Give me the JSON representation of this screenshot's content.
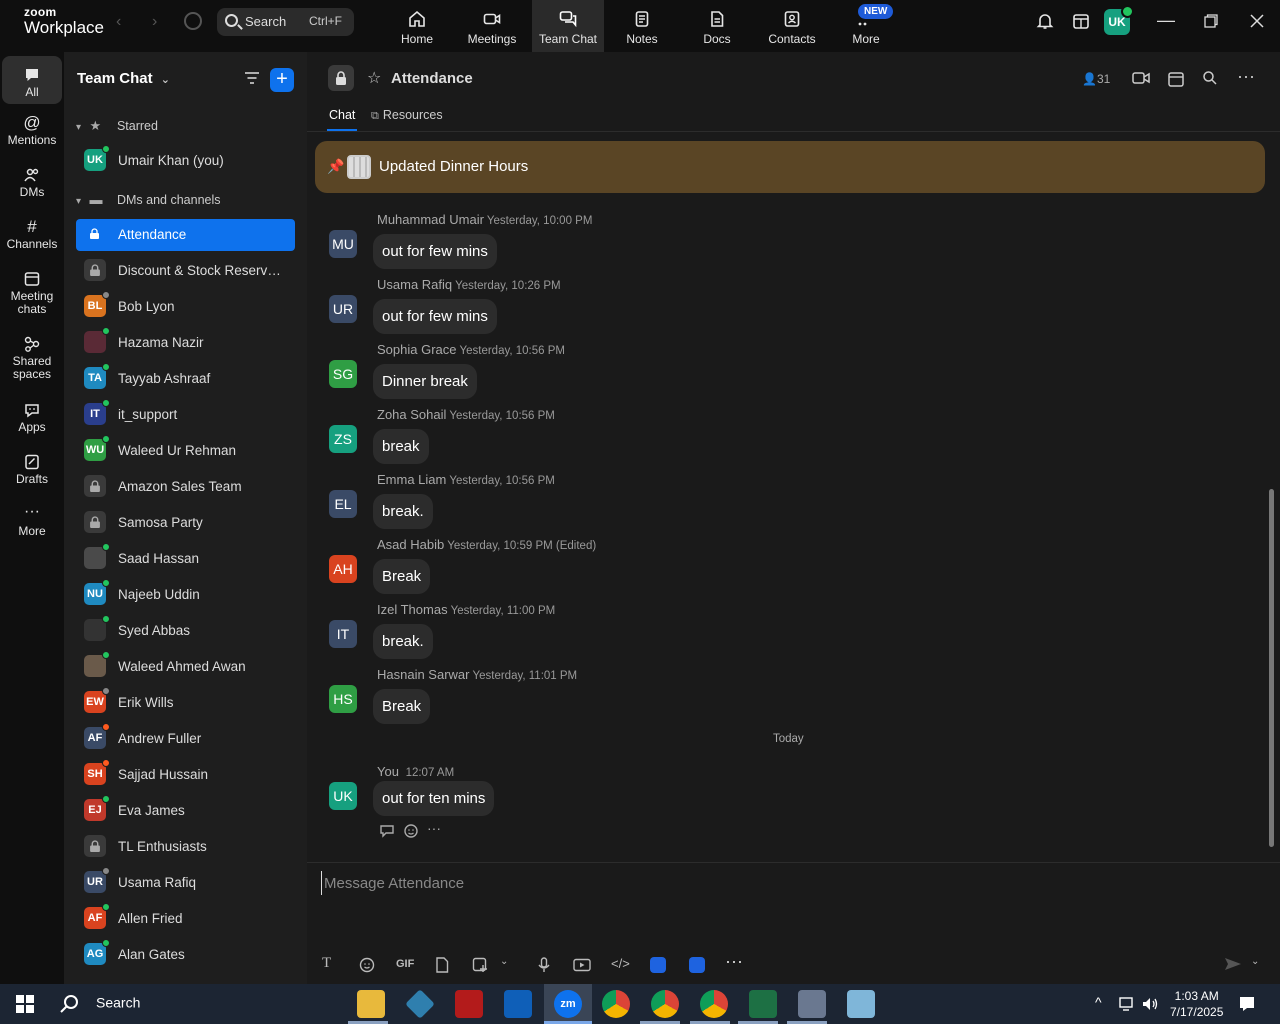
{
  "topbar": {
    "logo_line1": "zoom",
    "logo_line2": "Workplace",
    "search_label": "Search",
    "search_shortcut": "Ctrl+F",
    "tabs": [
      {
        "label": "Home",
        "icon": "home-icon"
      },
      {
        "label": "Meetings",
        "icon": "video-icon"
      },
      {
        "label": "Team Chat",
        "icon": "chat-icon"
      },
      {
        "label": "Notes",
        "icon": "notes-icon"
      },
      {
        "label": "Docs",
        "icon": "docs-icon"
      },
      {
        "label": "Contacts",
        "icon": "contacts-icon"
      },
      {
        "label": "More",
        "icon": "more-icon"
      }
    ],
    "new_badge": "NEW",
    "avatar_initials": "UK"
  },
  "rail": {
    "items": [
      {
        "label": "All",
        "icon": "chat-bubble-icon"
      },
      {
        "label": "Mentions",
        "icon": "at-icon"
      },
      {
        "label": "DMs",
        "icon": "people-icon"
      },
      {
        "label": "Channels",
        "icon": "hash-icon"
      },
      {
        "label": "Meeting chats",
        "icon": "calendar-icon"
      },
      {
        "label": "Shared spaces",
        "icon": "shared-spaces-icon"
      },
      {
        "label": "Apps",
        "icon": "apps-icon"
      },
      {
        "label": "Drafts",
        "icon": "drafts-icon"
      },
      {
        "label": "More",
        "icon": "ellipsis-icon"
      }
    ]
  },
  "chatlist": {
    "title": "Team Chat",
    "starred_label": "Starred",
    "dms_label": "DMs and channels",
    "starred": [
      {
        "name": "Umair Khan (you)",
        "initials": "UK",
        "color": "#16a07f",
        "status": "#22c55e"
      }
    ],
    "items": [
      {
        "name": "Attendance",
        "type": "channel",
        "active": true
      },
      {
        "name": "Discount & Stock Reservati...",
        "type": "channel"
      },
      {
        "name": "Bob Lyon",
        "initials": "BL",
        "color": "#d9731f",
        "status": "#888888"
      },
      {
        "name": "Hazama Nazir",
        "initials": "",
        "color": "#5a2a36",
        "status": "#22c55e"
      },
      {
        "name": "Tayyab Ashraaf",
        "initials": "TA",
        "color": "#1f8ac0",
        "status": "#22c55e"
      },
      {
        "name": "it_support",
        "initials": "IT",
        "color": "#2a3e8c",
        "status": "#22c55e"
      },
      {
        "name": "Waleed Ur Rehman",
        "initials": "WU",
        "color": "#2f9e44",
        "status": "#22c55e"
      },
      {
        "name": "Amazon Sales Team",
        "type": "channel"
      },
      {
        "name": "Samosa Party",
        "type": "channel"
      },
      {
        "name": "Saad Hassan",
        "initials": "",
        "color": "#4a4a4a",
        "status": "#22c55e"
      },
      {
        "name": "Najeeb Uddin",
        "initials": "NU",
        "color": "#1f8ac0",
        "status": "#22c55e"
      },
      {
        "name": "Syed Abbas",
        "initials": "",
        "color": "#333333",
        "status": "#22c55e"
      },
      {
        "name": "Waleed Ahmed Awan",
        "initials": "",
        "color": "#6a5a4a",
        "status": "#22c55e"
      },
      {
        "name": "Erik Wills",
        "initials": "EW",
        "color": "#d9431f",
        "status": "#888888"
      },
      {
        "name": "Andrew Fuller",
        "initials": "AF",
        "color": "#3a4a66",
        "status": "#ff5a1f"
      },
      {
        "name": "Sajjad Hussain",
        "initials": "SH",
        "color": "#d9431f",
        "status": "#ff5a1f"
      },
      {
        "name": "Eva James",
        "initials": "EJ",
        "color": "#c0392b",
        "status": "#22c55e"
      },
      {
        "name": "TL Enthusiasts",
        "type": "channel"
      },
      {
        "name": "Usama Rafiq",
        "initials": "UR",
        "color": "#3a4a66",
        "status": "#888888"
      },
      {
        "name": "Allen Fried",
        "initials": "AF",
        "color": "#d9431f",
        "status": "#22c55e"
      },
      {
        "name": "Alan Gates",
        "initials": "AG",
        "color": "#1f8ac0",
        "status": "#22c55e"
      }
    ]
  },
  "channel": {
    "title": "Attendance",
    "member_count": "31",
    "tabs": [
      {
        "label": "Chat"
      },
      {
        "label": "Resources"
      }
    ],
    "pinned_text": "Updated Dinner Hours",
    "messages": [
      {
        "sender": "Muhammad Umair",
        "time": "Yesterday, 10:00 PM",
        "text": "out for few mins",
        "initials": "MU",
        "color": "#3a4a66"
      },
      {
        "sender": "Usama Rafiq",
        "time": "Yesterday, 10:26 PM",
        "text": "out for few mins",
        "initials": "UR",
        "color": "#3a4a66"
      },
      {
        "sender": "Sophia Grace",
        "time": "Yesterday, 10:56 PM",
        "text": "Dinner break",
        "initials": "SG",
        "color": "#2f9e44"
      },
      {
        "sender": "Zoha Sohail",
        "time": "Yesterday, 10:56 PM",
        "text": "break",
        "initials": "ZS",
        "color": "#16a07f"
      },
      {
        "sender": "Emma Liam",
        "time": "Yesterday, 10:56 PM",
        "text": "break.",
        "initials": "EL",
        "color": "#3a4a66"
      },
      {
        "sender": "Asad Habib",
        "time": "Yesterday, 10:59 PM (Edited)",
        "text": "Break",
        "initials": "AH",
        "color": "#d9431f"
      },
      {
        "sender": "Izel Thomas",
        "time": "Yesterday, 11:00 PM",
        "text": "break.",
        "initials": "IT",
        "color": "#3a4a66"
      },
      {
        "sender": "Hasnain Sarwar",
        "time": "Yesterday, 11:01 PM",
        "text": "Break",
        "initials": "HS",
        "color": "#2f9e44"
      }
    ],
    "day_divider": "Today",
    "my_message": {
      "sender": "You",
      "time": "12:07 AM",
      "text": "out for ten mins",
      "initials": "UK",
      "color": "#16a07f"
    },
    "compose_placeholder": "Message Attendance",
    "gif_label": "GIF"
  },
  "taskbar": {
    "search_label": "Search",
    "time": "1:03 AM",
    "date": "7/17/2025"
  }
}
